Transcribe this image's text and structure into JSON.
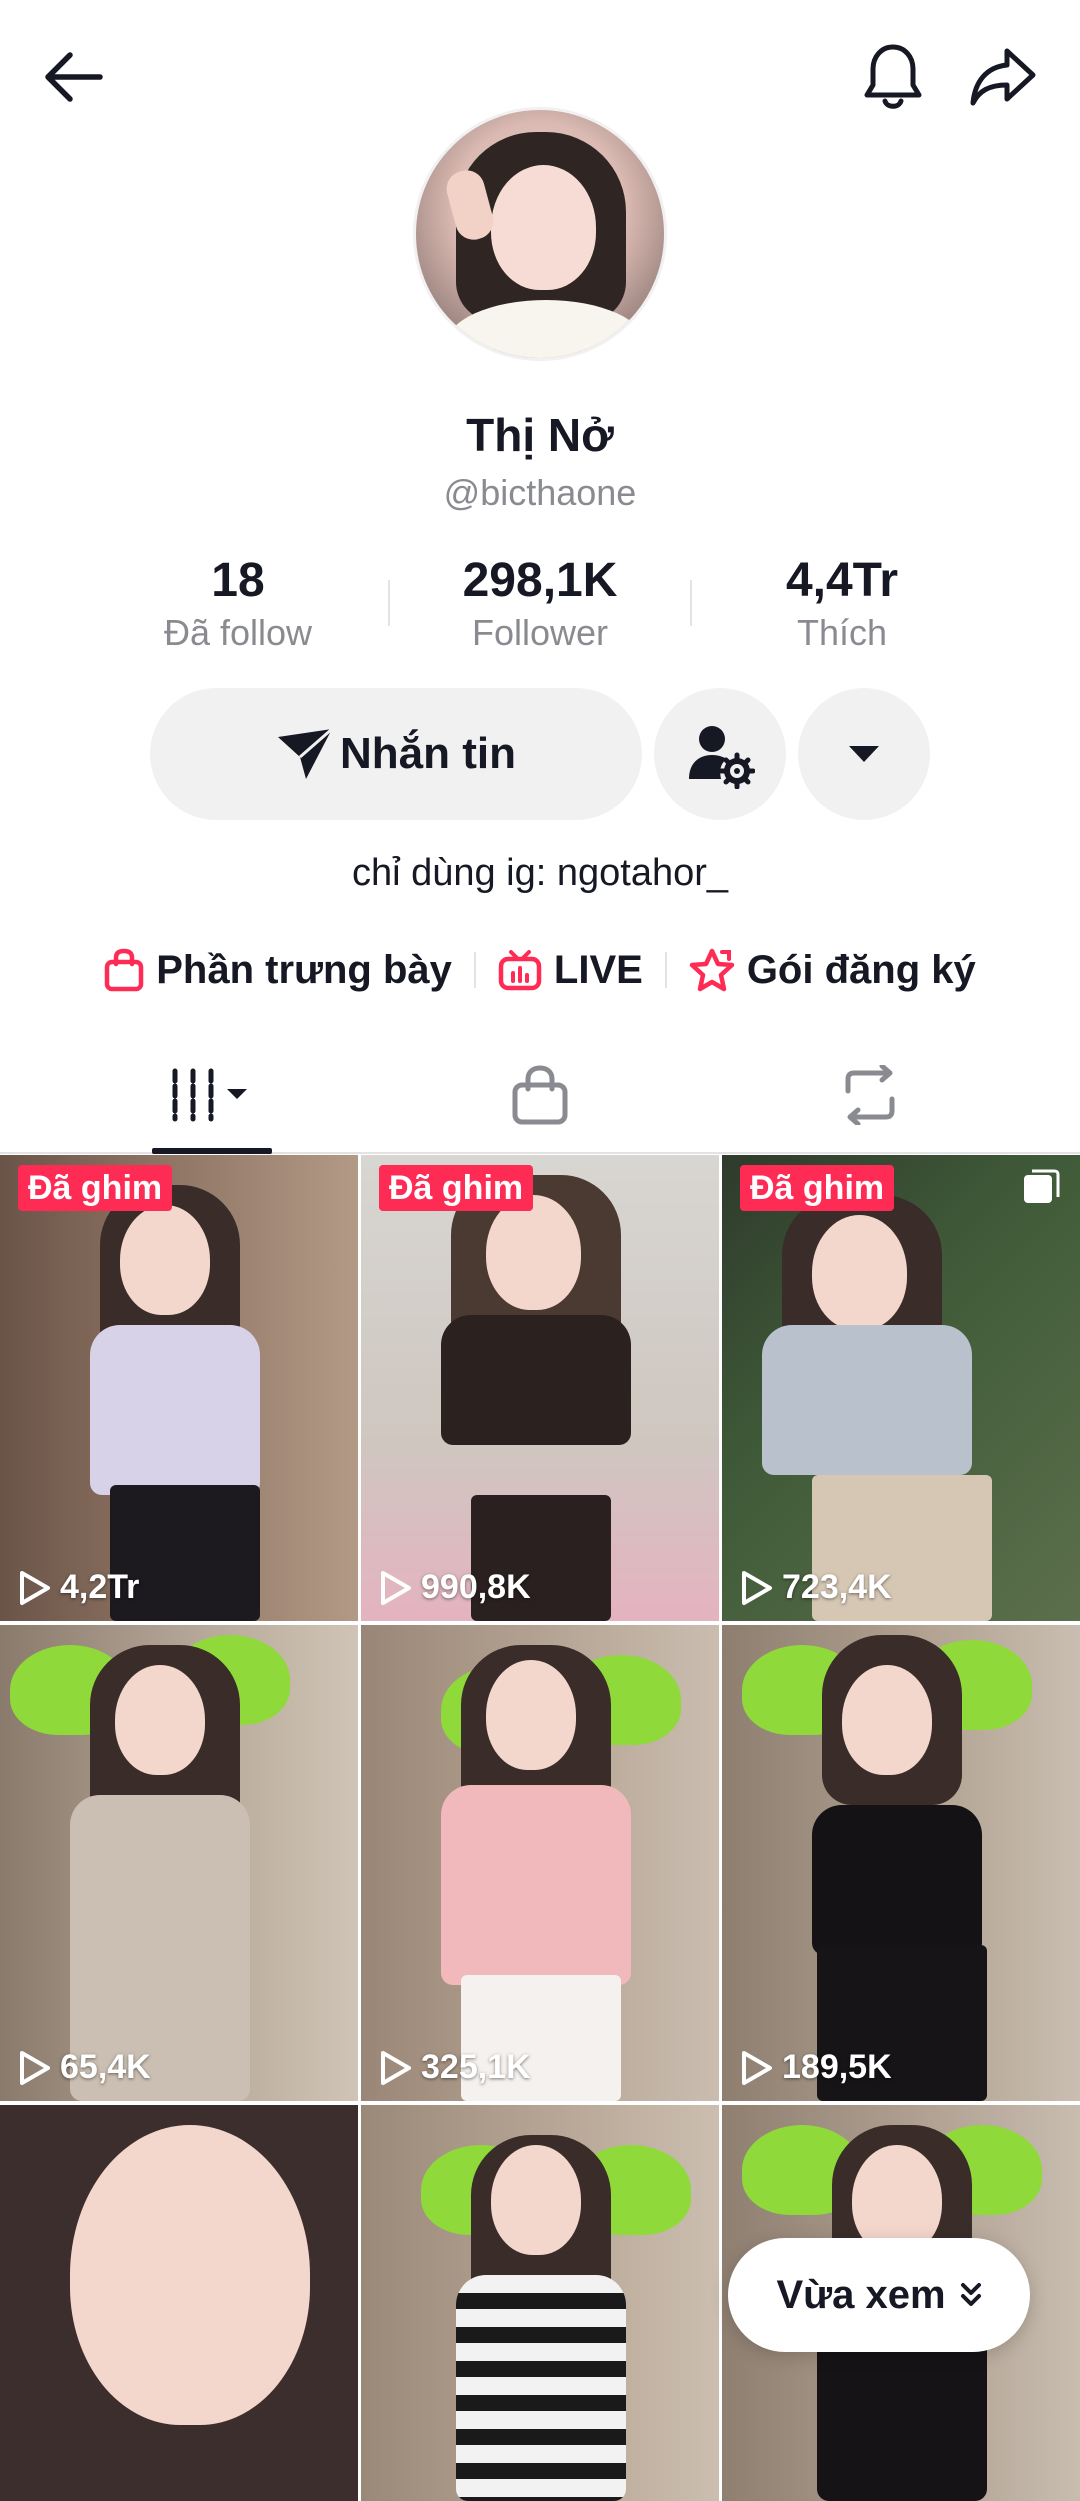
{
  "header": {
    "back_icon": "arrow-left-icon",
    "bell_icon": "bell-icon",
    "share_icon": "share-arrow-icon"
  },
  "profile": {
    "name": "Thị Nở",
    "handle": "@bicthaone"
  },
  "stats": [
    {
      "value": "18",
      "label": "Đã follow"
    },
    {
      "value": "298,1K",
      "label": "Follower"
    },
    {
      "value": "4,4Tr",
      "label": "Thích"
    }
  ],
  "actions": {
    "message_label": "Nhắn tin",
    "message_icon": "send-icon",
    "friend_icon": "user-gear-icon",
    "more_icon": "caret-down-icon"
  },
  "bio": "chỉ dùng ig: ngotahor_",
  "links": [
    {
      "label": "Phần trưng bày",
      "icon": "shopping-bag-icon"
    },
    {
      "label": "LIVE",
      "icon": "tv-icon"
    },
    {
      "label": "Gói đăng ký",
      "icon": "star-icon"
    }
  ],
  "tabs": [
    {
      "name": "videos",
      "icon": "grid-lines-icon"
    },
    {
      "name": "shop",
      "icon": "bag-icon"
    },
    {
      "name": "reposts",
      "icon": "repost-icon"
    }
  ],
  "videos": [
    {
      "views": "4,2Tr",
      "pinned": "Đã ghim"
    },
    {
      "views": "990,8K",
      "pinned": "Đã ghim"
    },
    {
      "views": "723,4K",
      "pinned": "Đã ghim"
    },
    {
      "views": "65,4K"
    },
    {
      "views": "325,1K"
    },
    {
      "views": "189,5K"
    },
    {
      "views": ""
    },
    {
      "views": ""
    },
    {
      "views": ""
    }
  ],
  "recently_watched": {
    "label": "Vừa xem"
  },
  "colors": {
    "accent": "#fe2c55",
    "button_bg": "#f1f1f2",
    "text_primary": "#161823",
    "text_secondary": "#8a8b91"
  }
}
